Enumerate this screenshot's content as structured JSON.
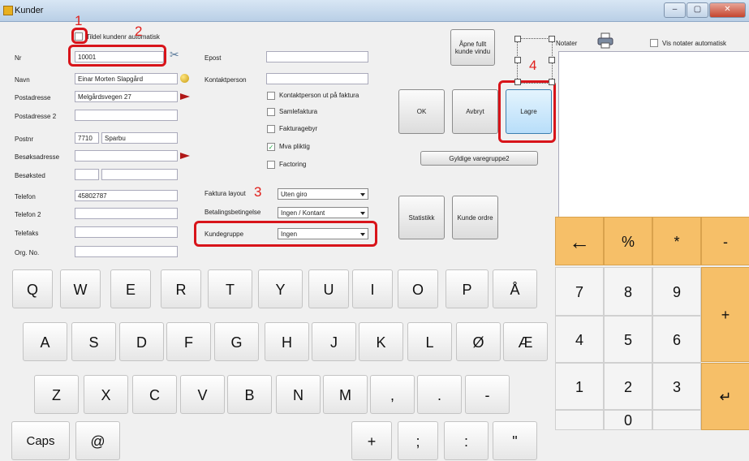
{
  "window": {
    "title": "Kunder",
    "min": "–",
    "max": "▢",
    "close": "✕"
  },
  "form": {
    "auto_checkbox_label": "Tildel kundenr automatisk",
    "fields_left": [
      {
        "label": "Nr",
        "value": "10001"
      },
      {
        "label": "Navn",
        "value": "Einar Morten Slapgård"
      },
      {
        "label": "Postadresse",
        "value": "Melgårdsvegen 27"
      },
      {
        "label": "Postadresse 2",
        "value": ""
      },
      {
        "label": "Postnr",
        "value": "7710",
        "extra": "Sparbu"
      },
      {
        "label": "Besøksadresse",
        "value": ""
      },
      {
        "label": "Besøksted",
        "value": ""
      },
      {
        "label": "Telefon",
        "value": "45802787"
      },
      {
        "label": "Telefon 2",
        "value": ""
      },
      {
        "label": "Telefaks",
        "value": ""
      },
      {
        "label": "Org. No.",
        "value": ""
      }
    ],
    "epost_label": "Epost",
    "kontaktperson_label": "Kontaktperson",
    "checkboxes": [
      {
        "label": "Kontaktperson ut på faktura",
        "checked": false
      },
      {
        "label": "Samlefaktura",
        "checked": false
      },
      {
        "label": "Fakturagebyr",
        "checked": false
      },
      {
        "label": "Mva pliktig",
        "checked": true
      },
      {
        "label": "Factoring",
        "checked": false
      }
    ],
    "faktura_layout_label": "Faktura layout",
    "faktura_layout_value": "Uten giro",
    "betaling_label": "Betalingsbetingelse",
    "betaling_value": "Ingen / Kontant",
    "kundegruppe_label": "Kundegruppe",
    "kundegruppe_value": "Ingen"
  },
  "buttons": {
    "open_full": "Åpne fullt kunde vindu",
    "ok": "OK",
    "avbryt": "Avbryt",
    "lagre": "Lagre",
    "gyldige": "Gyldige varegruppe2",
    "statistikk": "Statistikk",
    "kunde_ordre": "Kunde ordre"
  },
  "notes": {
    "label": "Notater",
    "show_auto_label": "Vis notater automatisk"
  },
  "annotations": [
    "1",
    "2",
    "3",
    "4"
  ],
  "keyboard": {
    "row1": [
      "Q",
      "W",
      "E",
      "R",
      "T",
      "Y",
      "U",
      "I",
      "O",
      "P",
      "Å"
    ],
    "row2": [
      "A",
      "S",
      "D",
      "F",
      "G",
      "H",
      "J",
      "K",
      "L",
      "Ø",
      "Æ"
    ],
    "row3": [
      "Z",
      "X",
      "C",
      "V",
      "B",
      "N",
      "M",
      ",",
      ".",
      "-"
    ],
    "row4_partial": [
      "Caps",
      "@",
      "+",
      ";",
      ":",
      "\"",
      "0"
    ]
  },
  "numpad": {
    "top": [
      "←",
      "%",
      "*",
      "-"
    ],
    "r1": [
      "7",
      "8",
      "9"
    ],
    "r2": [
      "4",
      "5",
      "6"
    ],
    "r3": [
      "1",
      "2",
      "3"
    ],
    "plus": "+",
    "enter": "↵"
  },
  "colors": {
    "annotation_red": "#d8141a",
    "numpad_orange": "#f6bf68",
    "lagre_blue": "#b8defa"
  }
}
